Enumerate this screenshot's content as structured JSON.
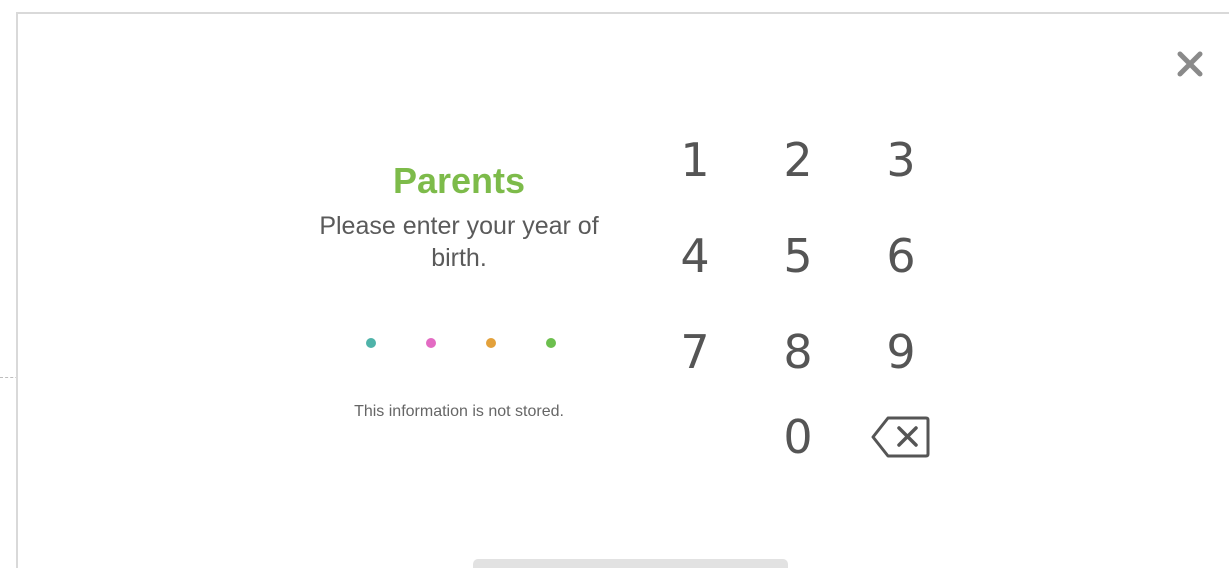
{
  "dialog": {
    "title": "Parents",
    "subtitle": "Please enter your year of birth.",
    "note": "This information is not stored.",
    "close_icon": "close-icon",
    "pin_dots": [
      {
        "color": "#4fb3a9"
      },
      {
        "color": "#e36bc3"
      },
      {
        "color": "#e3a13b"
      },
      {
        "color": "#6cbf4e"
      }
    ]
  },
  "keypad": {
    "keys": [
      "1",
      "2",
      "3",
      "4",
      "5",
      "6",
      "7",
      "8",
      "9",
      "0"
    ],
    "backspace_icon": "backspace-icon"
  },
  "colors": {
    "title": "#7dbb4a",
    "text": "#5a5a5a",
    "keys": "#555555"
  }
}
